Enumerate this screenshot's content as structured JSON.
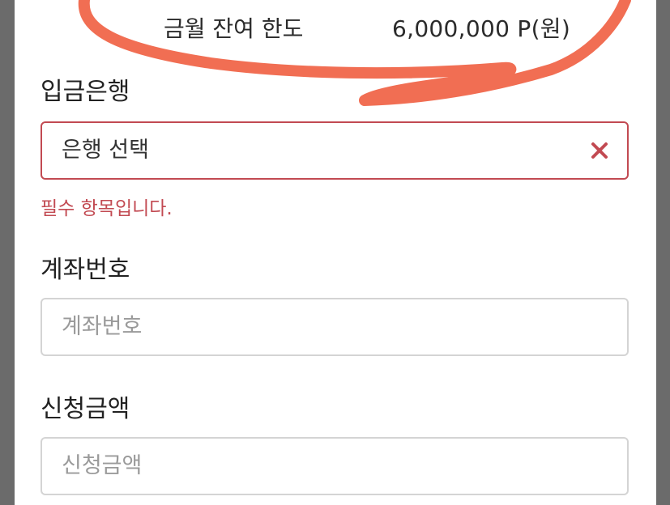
{
  "summary": {
    "remaining_limit_label": "금월 잔여 한도",
    "remaining_limit_value": "6,000,000 P(원)"
  },
  "bank": {
    "label": "입금은행",
    "value": "은행 선택",
    "error": "필수 항목입니다."
  },
  "account": {
    "label": "계좌번호",
    "placeholder": "계좌번호"
  },
  "amount": {
    "label": "신청금액",
    "placeholder": "신청금액"
  },
  "colors": {
    "error": "#c24a52",
    "annotation": "#f0664a",
    "border": "#d4d4d4"
  }
}
